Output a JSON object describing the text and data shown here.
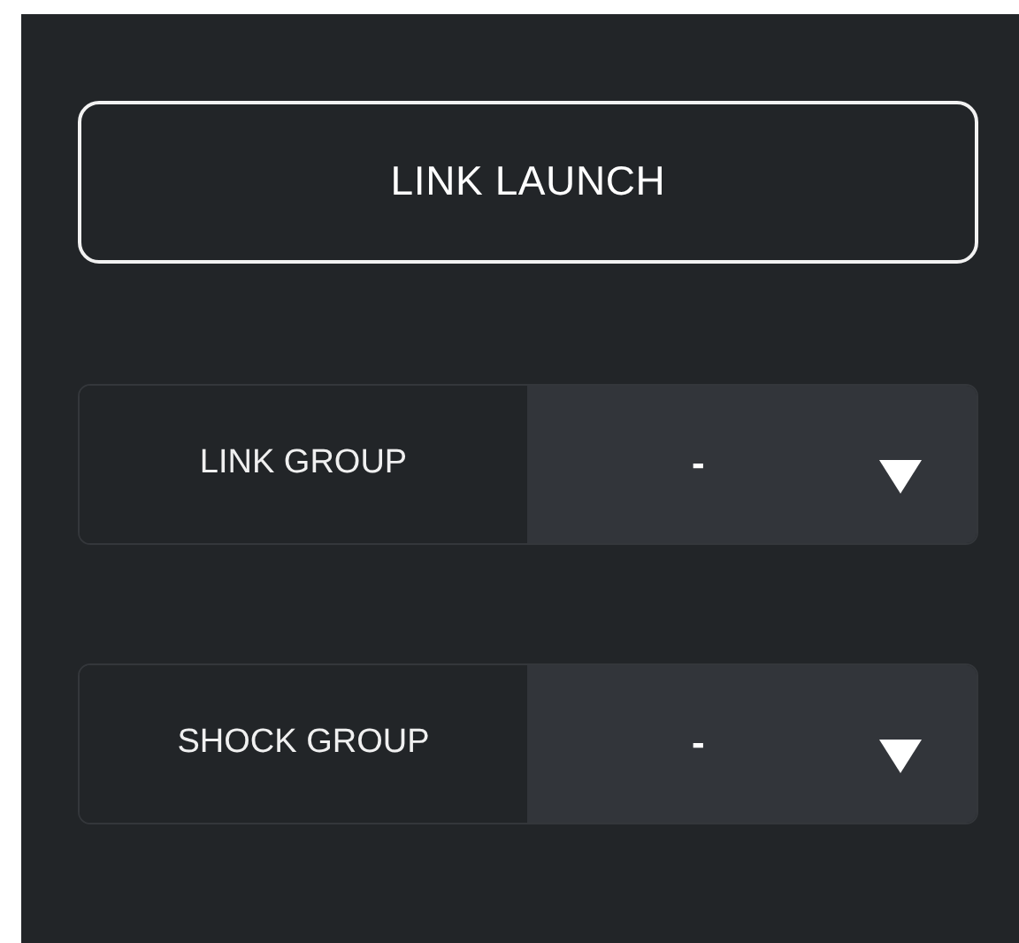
{
  "launch_button": {
    "label": "LINK LAUNCH"
  },
  "selectors": [
    {
      "label": "LINK GROUP",
      "value": "-"
    },
    {
      "label": "SHOCK GROUP",
      "value": "-"
    }
  ]
}
